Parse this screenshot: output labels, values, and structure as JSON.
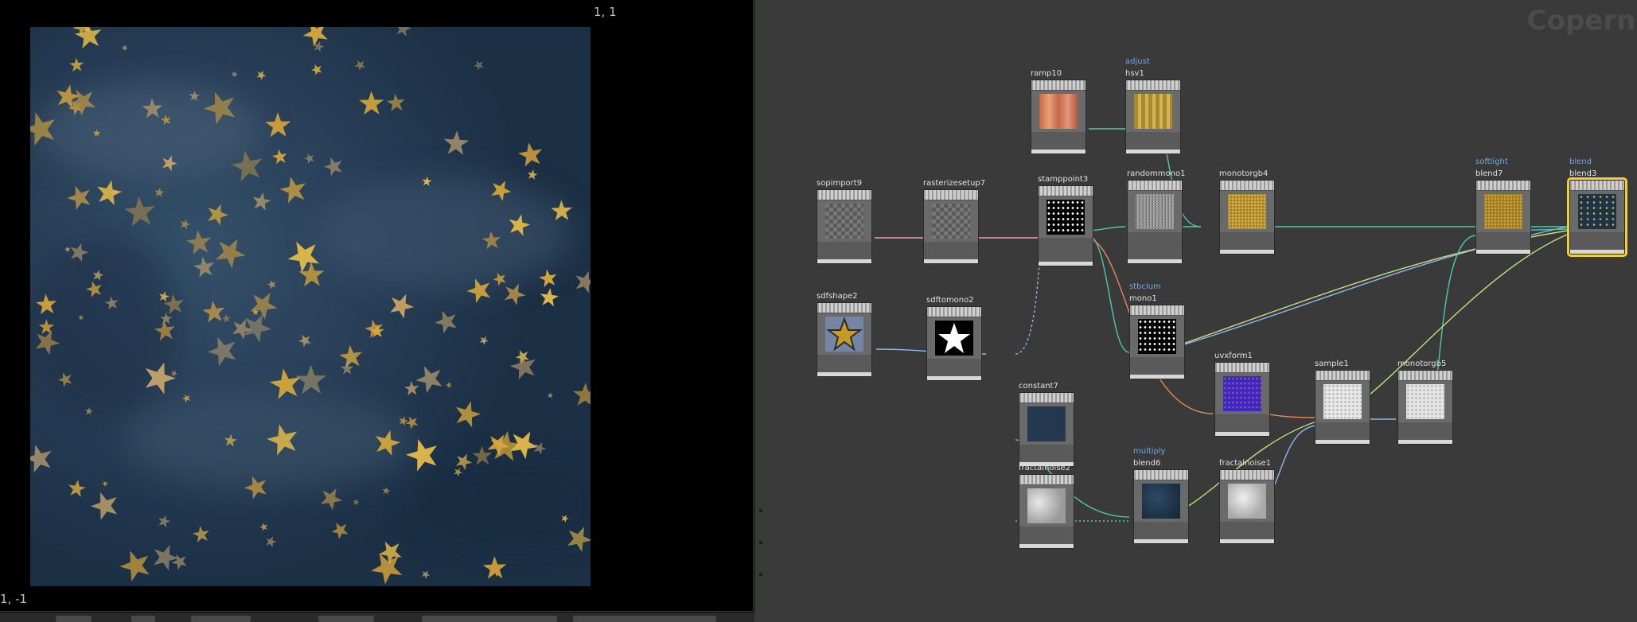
{
  "viewer": {
    "coord_top_right": "1, 1",
    "coord_bottom_left": "1, -1"
  },
  "network": {
    "context_label": "Coperni",
    "nodes": [
      {
        "id": "ramp10",
        "label": "ramp10",
        "tag": ""
      },
      {
        "id": "hsv1",
        "label": "hsv1",
        "tag": "adjust"
      },
      {
        "id": "sopimport9",
        "label": "sopimport9",
        "tag": ""
      },
      {
        "id": "rasterizesetup7",
        "label": "rasterizesetup7",
        "tag": ""
      },
      {
        "id": "stamppoint3",
        "label": "stamppoint3",
        "tag": ""
      },
      {
        "id": "randommono1",
        "label": "randommono1",
        "tag": ""
      },
      {
        "id": "monotorgb4",
        "label": "monotorgb4",
        "tag": ""
      },
      {
        "id": "blend7",
        "label": "blend7",
        "tag": "softlight"
      },
      {
        "id": "blend3",
        "label": "blend3",
        "tag": "blend"
      },
      {
        "id": "sdfshape2",
        "label": "sdfshape2",
        "tag": ""
      },
      {
        "id": "sdftomono2",
        "label": "sdftomono2",
        "tag": ""
      },
      {
        "id": "mono1",
        "label": "mono1",
        "tag": "stbclum"
      },
      {
        "id": "uvxform1",
        "label": "uvxform1",
        "tag": ""
      },
      {
        "id": "sample1",
        "label": "sample1",
        "tag": ""
      },
      {
        "id": "monotorgb5",
        "label": "monotorgb5",
        "tag": ""
      },
      {
        "id": "constant7",
        "label": "constant7",
        "tag": ""
      },
      {
        "id": "fractalnoise2",
        "label": "fractalnoise2",
        "tag": ""
      },
      {
        "id": "blend6",
        "label": "blend6",
        "tag": "multiply"
      },
      {
        "id": "fractalnoise1",
        "label": "fractalnoise1",
        "tag": ""
      }
    ]
  },
  "colors": {
    "selected_outline": "#f1d02c",
    "background": "#3a3a3a",
    "tag_text": "#6fa6e8"
  }
}
